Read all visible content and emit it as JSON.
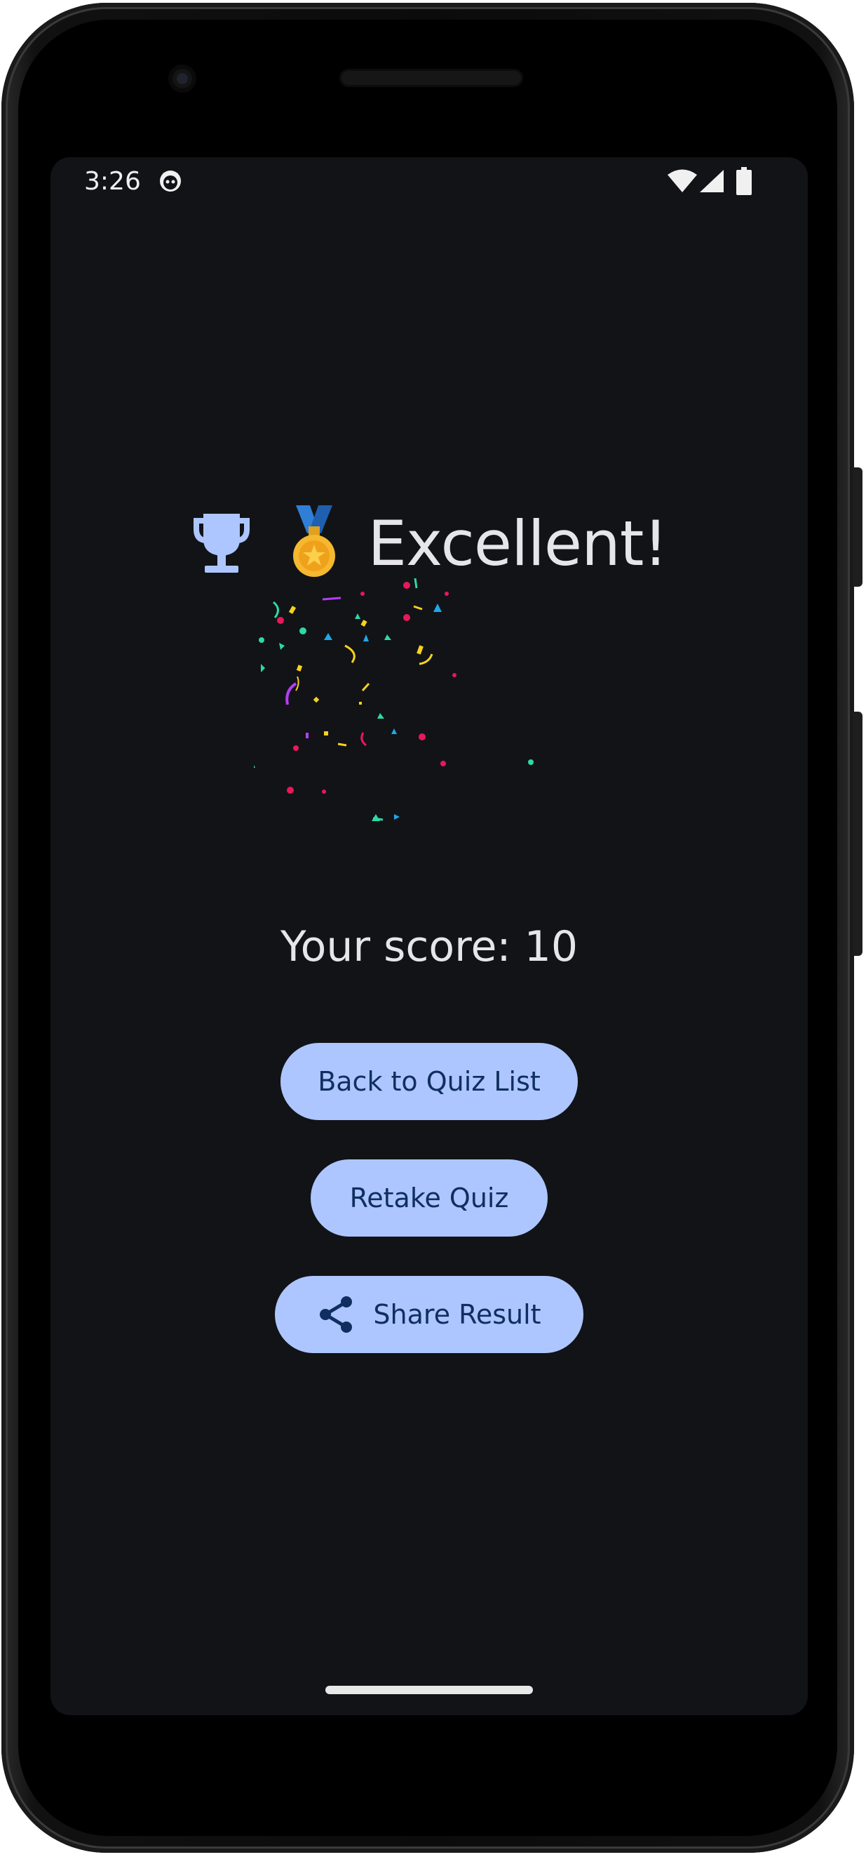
{
  "status_bar": {
    "time": "3:26"
  },
  "result": {
    "headline": "Excellent!",
    "score_text": "Your score: 10"
  },
  "actions": {
    "back_label": "Back to Quiz List",
    "retake_label": "Retake Quiz",
    "share_label": "Share Result"
  },
  "icons": {
    "trophy": "trophy-icon",
    "medal": "medal-icon",
    "share": "share-icon",
    "wifi": "wifi-icon",
    "signal": "signal-icon",
    "battery": "battery-icon"
  },
  "colors": {
    "background": "#121317",
    "button": "#adc6ff",
    "button_text": "#102f60",
    "text": "#e6e6ea"
  }
}
